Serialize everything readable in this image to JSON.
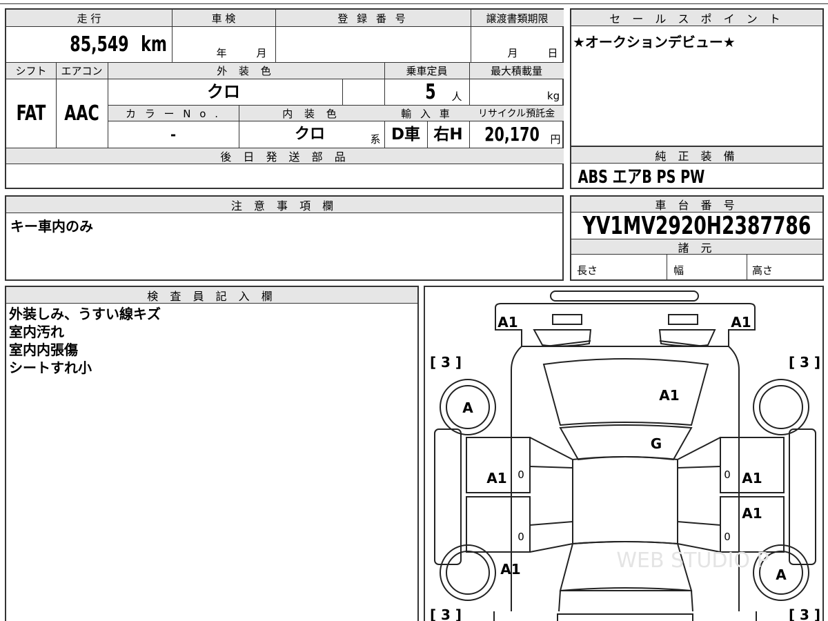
{
  "top": {
    "h_mileage": "走 行",
    "h_inspection": "車 検",
    "h_regnum": "登 録 番 号",
    "h_transfer": "譲渡書類期限",
    "h_sales": "セ ー ル ス ポ イ ン ト",
    "mileage": "85,549",
    "mileage_unit": "km",
    "year_unit": "年",
    "month_unit": "月",
    "transfer_month": "月",
    "transfer_day": "日",
    "sales_point": "★オークションデビュー★"
  },
  "spec": {
    "h_shift": "シフト",
    "h_aircon": "エアコン",
    "h_exterior": "外 装 色",
    "h_capacity": "乗車定員",
    "h_payload": "最大積載量",
    "shift": "FAT",
    "aircon": "AAC",
    "exterior_color": "クロ",
    "capacity": "5",
    "capacity_unit": "人",
    "payload_unit": "kg",
    "h_color_no": "カ ラ ー N o .",
    "h_interior": "内 装 色",
    "h_import": "輸 入 車",
    "h_recycle": "リサイクル預託金",
    "color_no": "-",
    "interior_color": "クロ",
    "interior_suffix": "系",
    "import_type": "D車",
    "steering": "右H",
    "recycle_fee": "20,170",
    "recycle_unit": "円"
  },
  "later_parts": {
    "header": "後 日 発 送 部 品",
    "value": ""
  },
  "equipment": {
    "header": "純 正 装 備",
    "value": "ABS エアB PS PW"
  },
  "notes": {
    "header": "注 意 事 項 欄",
    "value": "キー車内のみ"
  },
  "chassis": {
    "header": "車 台 番 号",
    "value": "YV1MV2920H2387786",
    "h_specs": "諸 元",
    "length": "長さ",
    "width": "幅",
    "height": "高さ"
  },
  "inspector": {
    "header": "検 査 員 記 入 欄",
    "lines": [
      "外装しみ、うすい線キズ",
      "室内汚れ",
      "室内内張傷",
      "シートすれ小"
    ]
  },
  "diagram": {
    "bracket_tl": "[ 3 ]",
    "bracket_tr": "[ 3 ]",
    "bracket_bl": "[ 3 ]",
    "bracket_br": "[ 3 ]",
    "m_front_left": "A1",
    "m_front_right": "A1",
    "m_hood": "A1",
    "m_windshield": "G",
    "m_wheel_fl": "A",
    "m_wheel_rr": "A",
    "m_door_fl": "A1",
    "m_door_fr": "A1",
    "m_door_rr": "A1",
    "m_rear_left": "A1",
    "zero": "0",
    "watermark": "WEB STUDIO P"
  }
}
